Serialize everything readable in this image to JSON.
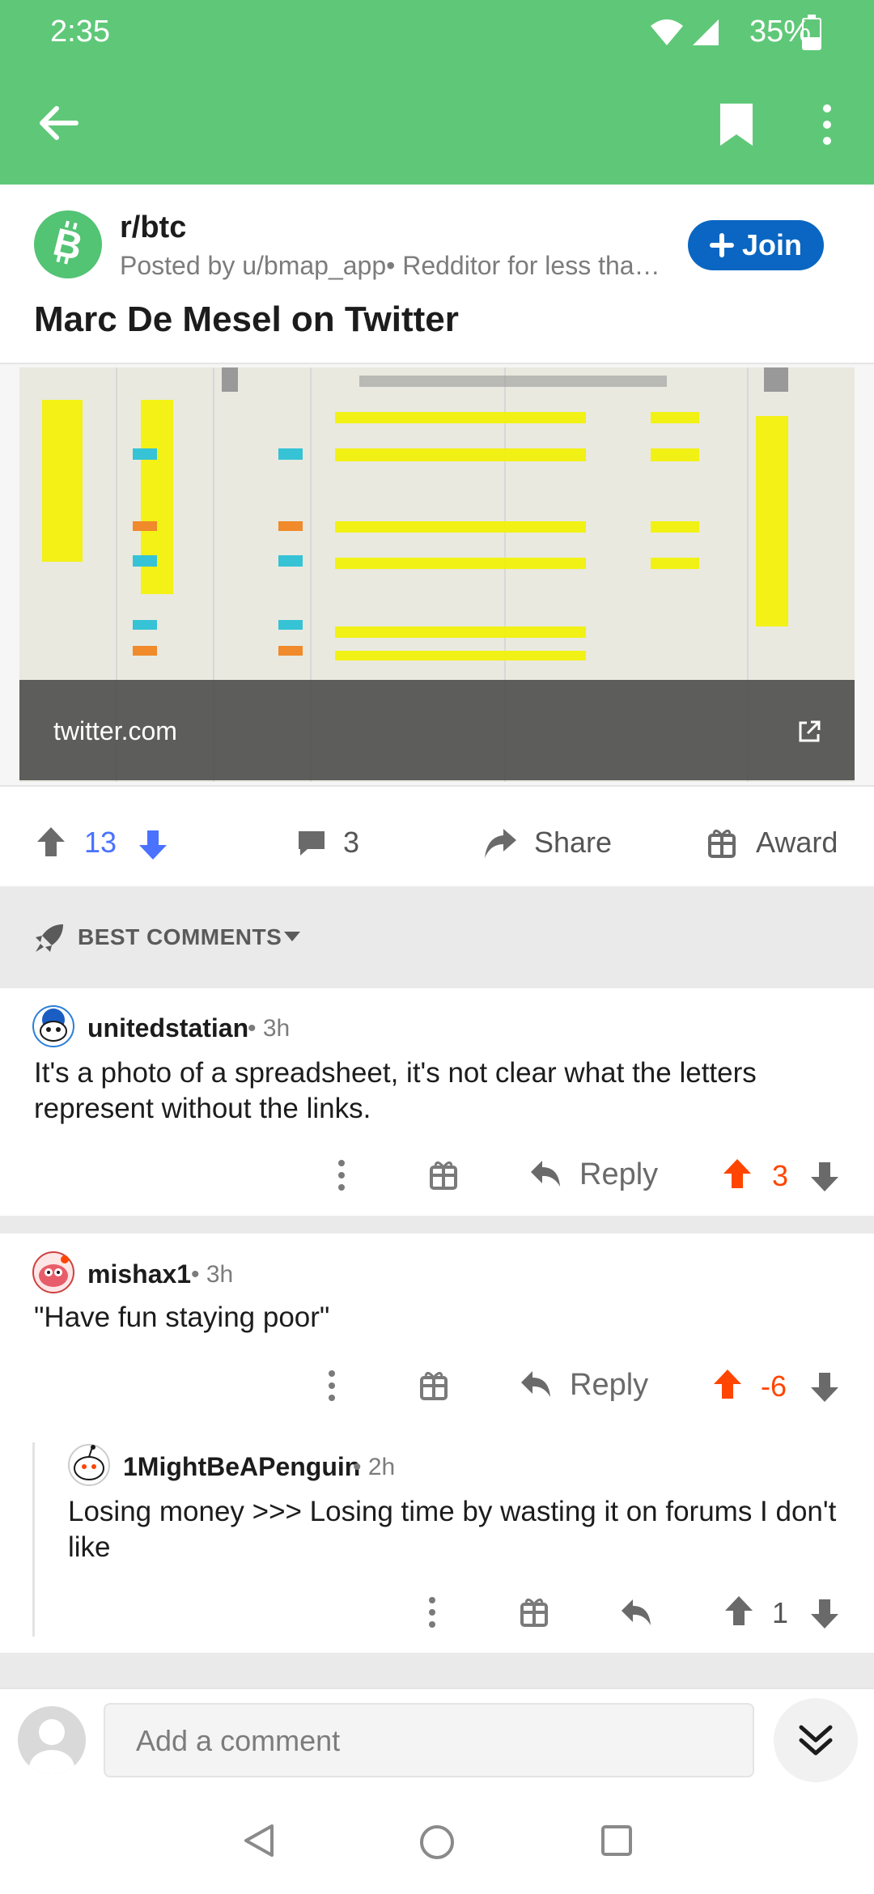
{
  "status_bar": {
    "time": "2:35",
    "battery": "35%"
  },
  "app_bar": {
    "back_icon": "arrow-left-icon",
    "bookmark_icon": "bookmark-icon",
    "more_icon": "more-vertical-icon"
  },
  "post": {
    "subreddit": "r/btc",
    "posted_by": "Posted by u/bmap_app• Redditor for less than ...",
    "join_label": "Join",
    "title": "Marc De Mesel on Twitter",
    "link_domain": "twitter.com",
    "score": "13",
    "comments": "3",
    "share_label": "Share",
    "award_label": "Award"
  },
  "sort": {
    "label": "BEST COMMENTS"
  },
  "comments": [
    {
      "author": "unitedstatian",
      "time": "3h",
      "body": "It's a photo of a spreadsheet, it's not clear what the letters represent without the links.",
      "reply_label": "Reply",
      "score": "3"
    },
    {
      "author": "mishax1",
      "time": "3h",
      "body": "\"Have fun staying poor\"",
      "reply_label": "Reply",
      "score": "-6"
    },
    {
      "author": "1MightBeAPenguin",
      "time": "2h",
      "body": "Losing money >>> Losing time by wasting it on forums I don't like",
      "score": "1"
    }
  ],
  "composer": {
    "placeholder": "Add a comment"
  },
  "colors": {
    "header": "#5fc878",
    "join": "#0a66c2",
    "upvote_active": "#ff4500",
    "score_blue": "#4a72ff"
  }
}
